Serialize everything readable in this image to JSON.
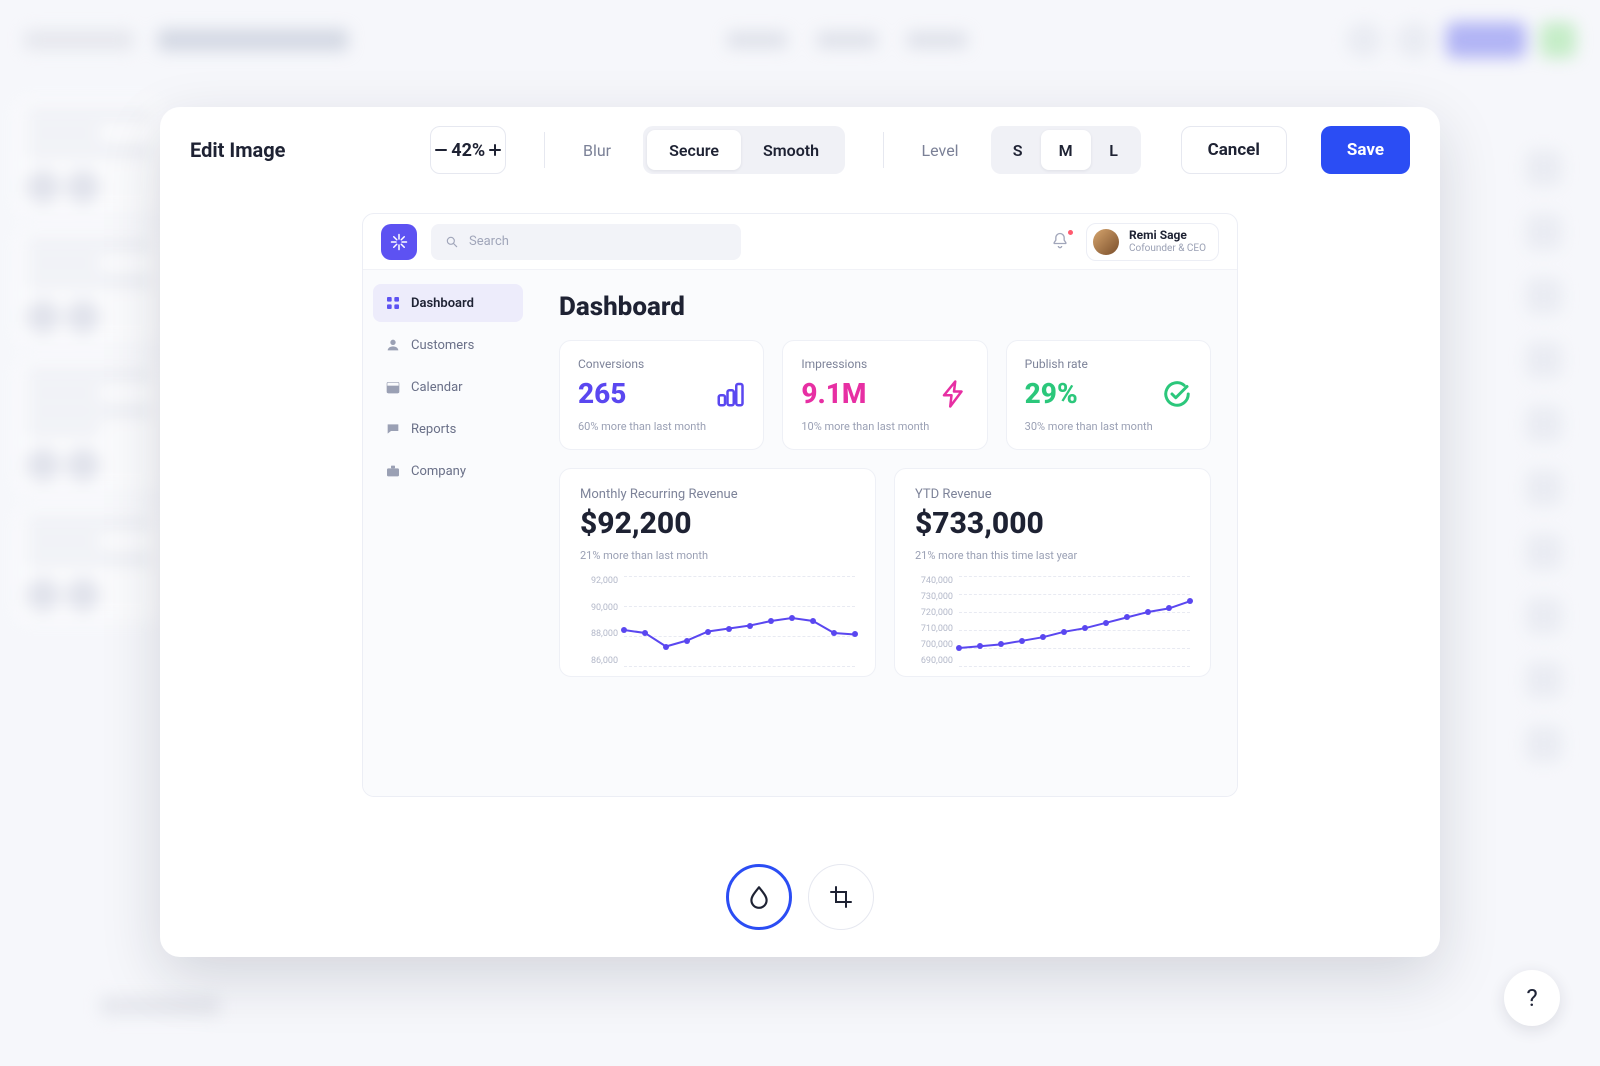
{
  "modal": {
    "title": "Edit Image",
    "zoom": "42%",
    "blur_label": "Blur",
    "blur_options": {
      "secure": "Secure",
      "smooth": "Smooth"
    },
    "level_label": "Level",
    "level_options": {
      "s": "S",
      "m": "M",
      "l": "L"
    },
    "cancel": "Cancel",
    "save": "Save"
  },
  "preview": {
    "search_placeholder": "Search",
    "user": {
      "name": "Remi Sage",
      "role": "Cofounder & CEO"
    },
    "nav": {
      "dashboard": "Dashboard",
      "customers": "Customers",
      "calendar": "Calendar",
      "reports": "Reports",
      "company": "Company"
    },
    "heading": "Dashboard",
    "kpis": {
      "conversions": {
        "label": "Conversions",
        "value": "265",
        "sub": "60% more than last month"
      },
      "impressions": {
        "label": "Impressions",
        "value": "9.1M",
        "sub": "10% more than last month"
      },
      "publish": {
        "label": "Publish rate",
        "value": "29%",
        "sub": "30% more than last month"
      }
    },
    "panels": {
      "mrr": {
        "title": "Monthly Recurring Revenue",
        "value": "$92,200",
        "sub": "21% more than last month"
      },
      "ytd": {
        "title": "YTD Revenue",
        "value": "$733,000",
        "sub": "21% more than this time last year"
      }
    }
  },
  "chart_data": [
    {
      "type": "line",
      "title": "Monthly Recurring Revenue",
      "ylabel": "",
      "ylim": [
        86000,
        92000
      ],
      "y_ticks": [
        "92,000",
        "90,000",
        "88,000",
        "86,000"
      ],
      "x": [
        1,
        2,
        3,
        4,
        5,
        6,
        7,
        8,
        9,
        10,
        11,
        12
      ],
      "values": [
        88400,
        88200,
        87300,
        87700,
        88300,
        88500,
        88700,
        89000,
        89200,
        89000,
        88200,
        88100
      ]
    },
    {
      "type": "line",
      "title": "YTD Revenue",
      "ylabel": "",
      "ylim": [
        690000,
        740000
      ],
      "y_ticks": [
        "740,000",
        "730,000",
        "720,000",
        "710,000",
        "700,000",
        "690,000"
      ],
      "x": [
        1,
        2,
        3,
        4,
        5,
        6,
        7,
        8,
        9,
        10,
        11,
        12
      ],
      "values": [
        700000,
        701000,
        702000,
        704000,
        706000,
        709000,
        711000,
        714000,
        717000,
        720000,
        722000,
        726000
      ]
    }
  ],
  "help": "?"
}
